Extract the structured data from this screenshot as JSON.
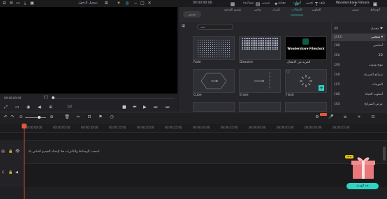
{
  "titlebar": {
    "app_name": "Wondershare Filmora",
    "menu": [
      "ملف",
      "تحرير",
      "أدوات",
      "معاينة",
      "تصدير",
      "مساعدة"
    ],
    "timecode": "00:00:00:00",
    "login": "تسجيل الدخول"
  },
  "toolbar": {
    "items": [
      {
        "label": "الوسائط",
        "icon": "media-icon"
      },
      {
        "label": "صوتي",
        "icon": "audio-icon"
      },
      {
        "label": "العناوين",
        "icon": "titles-icon"
      },
      {
        "label": "الانتقالات",
        "icon": "transitions-icon",
        "active": true
      },
      {
        "label": "تأثيرات",
        "icon": "effects-icon"
      },
      {
        "label": "عناصر",
        "icon": "elements-icon"
      },
      {
        "label": "تقسيم الشاشة",
        "icon": "split-screen-icon"
      }
    ],
    "export_label": "تصدير"
  },
  "preview": {
    "time_left": "00:00:00:00",
    "page_indicator": "1/2"
  },
  "library": {
    "search_placeholder": "بحث",
    "thumbs": [
      {
        "label": "Fade"
      },
      {
        "label": "Dissolve"
      },
      {
        "label": "المزيد من الانتقال",
        "promo_title": "Wondershare Filmstock"
      },
      {
        "label": "Cube"
      },
      {
        "label": "Erase"
      },
      {
        "label": "Flash"
      }
    ]
  },
  "sidebar": {
    "items": [
      {
        "label": "مفضل",
        "count": "(0)"
      },
      {
        "label": "منتخبي",
        "count": "(233)",
        "selected": true
      },
      {
        "label": "أساسي",
        "count": "(18)"
      },
      {
        "label": "3D",
        "count": "(31)"
      },
      {
        "label": "موج وموب",
        "count": "(20)"
      },
      {
        "label": "شرائح السرعة",
        "count": "(14)"
      },
      {
        "label": "الموجات",
        "count": "(37)"
      },
      {
        "label": "أسلوب الحياة",
        "count": "(18)"
      },
      {
        "label": "عرض الشرائح",
        "count": "(31)"
      }
    ]
  },
  "timeline": {
    "ticks": [
      "00:00:00:00",
      "00:00:05:00",
      "00:00:10:00",
      "00:00:15:00",
      "00:00:20:00",
      "00:00:25:00",
      "00:00:30:00",
      "00:00:35:00",
      "00:00:40:00",
      "00:00:45:00",
      "00:00:50:00",
      "00:00:55:00"
    ],
    "hint": "اسحب الوسائط والتأثيرات هنا لإنشاء الفيديو الخاص بك."
  },
  "gift": {
    "badge": "NEW",
    "button_label": "خذ الهدية"
  }
}
